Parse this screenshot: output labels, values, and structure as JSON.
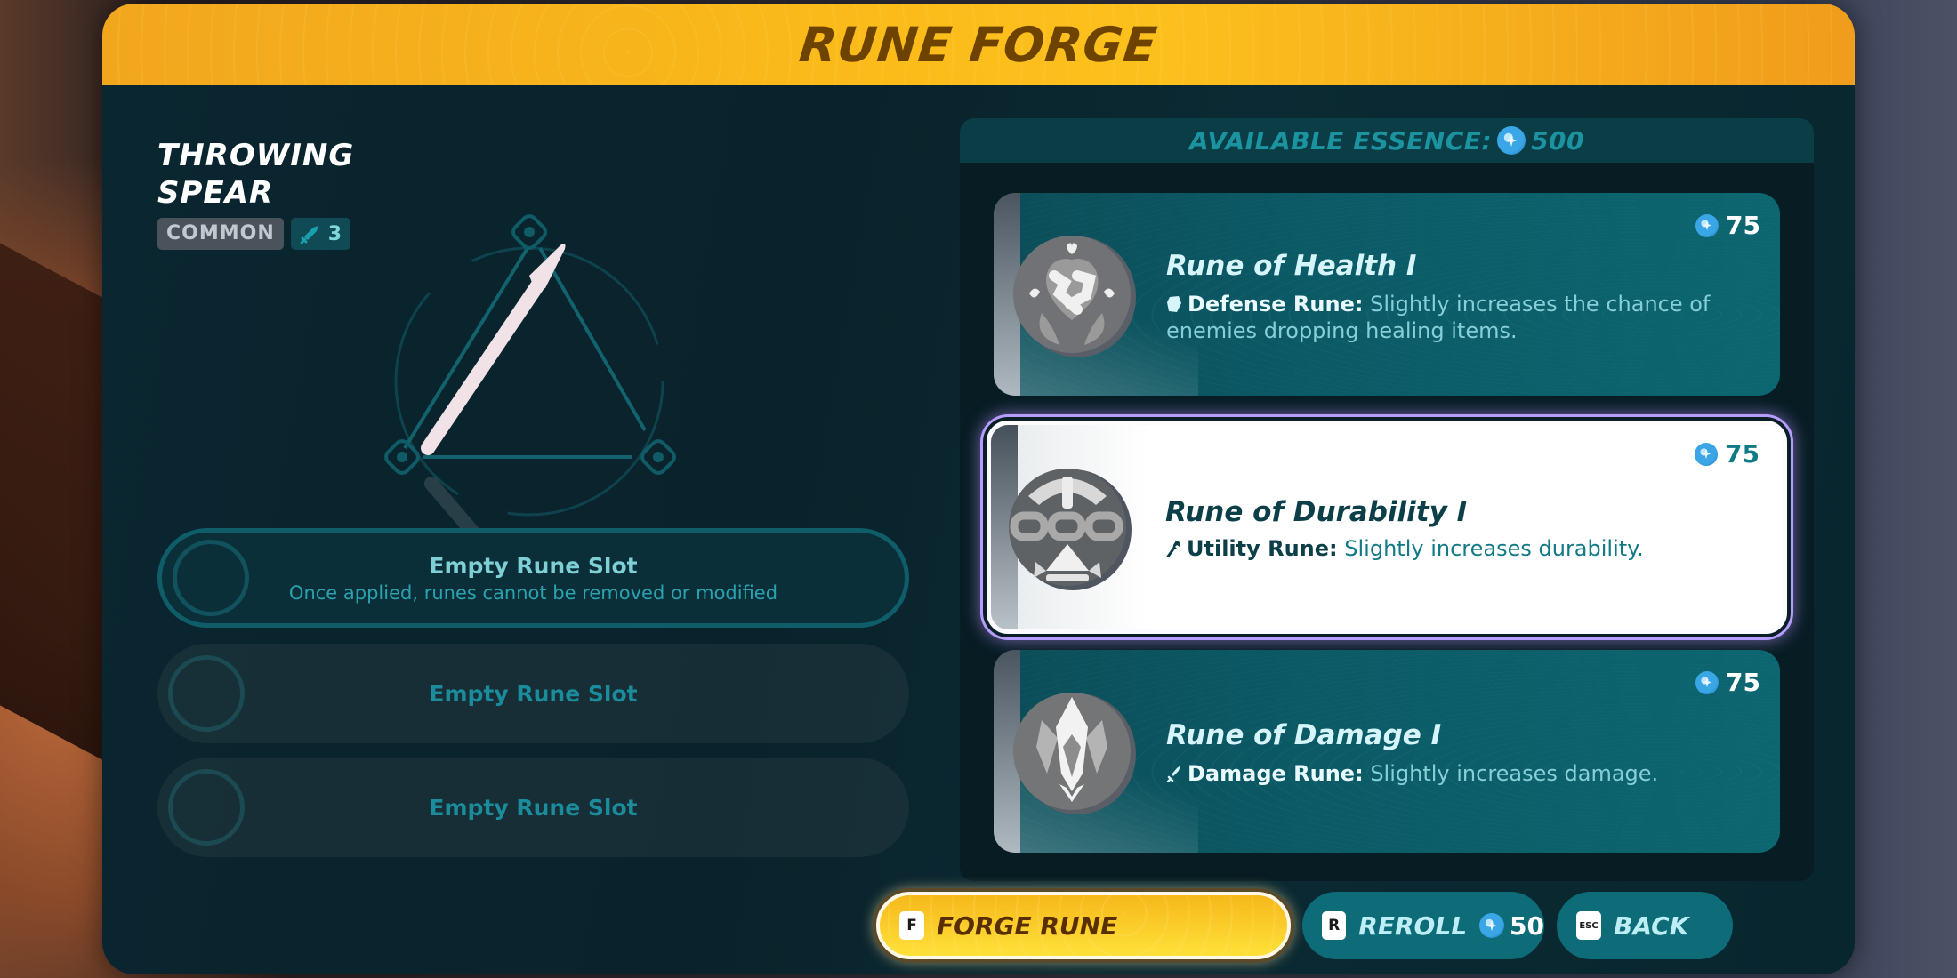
{
  "window": {
    "title": "RUNE FORGE"
  },
  "item": {
    "name": "THROWING SPEAR",
    "rarity": "COMMON",
    "tier_icon": "sword-icon",
    "tier_value": "3"
  },
  "slots": [
    {
      "title": "Empty Rune Slot",
      "subtitle": "Once applied, runes cannot be removed or modified",
      "active": true
    },
    {
      "title": "Empty Rune Slot",
      "active": false
    },
    {
      "title": "Empty Rune Slot",
      "active": false
    }
  ],
  "essence": {
    "label": "AVAILABLE ESSENCE:",
    "icon": "essence-coin-icon",
    "value": "500"
  },
  "runes": [
    {
      "name": "Rune of Health I",
      "category": "Defense Rune:",
      "category_icon": "shield-icon",
      "description": "Slightly increases the chance of enemies dropping healing items.",
      "cost": "75",
      "selected": false
    },
    {
      "name": "Rune of Durability I",
      "category": "Utility Rune:",
      "category_icon": "wrench-icon",
      "description": "Slightly increases durability.",
      "cost": "75",
      "selected": true
    },
    {
      "name": "Rune of Damage I",
      "category": "Damage Rune:",
      "category_icon": "sword-icon",
      "description": "Slightly increases damage.",
      "cost": "75",
      "selected": false
    }
  ],
  "actions": {
    "forge": {
      "key": "F",
      "label": "FORGE RUNE"
    },
    "reroll": {
      "key": "R",
      "label": "REROLL",
      "cost": "50"
    },
    "back": {
      "key": "ESC",
      "label": "BACK"
    }
  },
  "colors": {
    "header": "#fbbc1a",
    "title_text": "#6e4300",
    "panel": "#0a2630",
    "card": "#0b5a66",
    "selected_glow": "#b79cff",
    "accent_teal": "#1b93a0"
  }
}
